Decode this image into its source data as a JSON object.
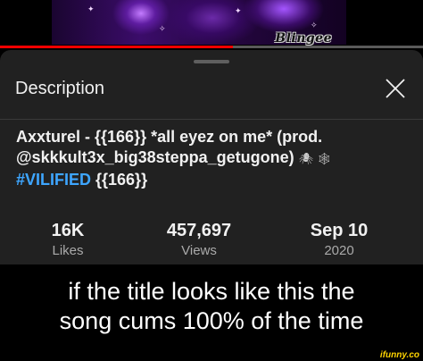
{
  "video": {
    "watermark": "Blingee",
    "progress_percent": 55,
    "progress_color": "#ff0000"
  },
  "sheet": {
    "title": "Description",
    "close_icon": "close-x-icon",
    "description": {
      "line1": "Axxturel - {{166}} *all eyez on me* (prod.",
      "line2": "@skkkult3x_big38steppa_getugone)",
      "line2_emojis": "🕷 🕸",
      "line3_hashtag": "#VILIFIED",
      "line3_rest": " {{166}}"
    },
    "stats": [
      {
        "value": "16K",
        "label": "Likes"
      },
      {
        "value": "457,697",
        "label": "Views"
      },
      {
        "value": "Sep 10",
        "label": "2020"
      }
    ],
    "hashtag_color": "#3ea6ff"
  },
  "caption": {
    "line1": "if the title looks like this the",
    "line2": "song cums 100% of the time"
  },
  "watermark_site": "ifunny.co"
}
